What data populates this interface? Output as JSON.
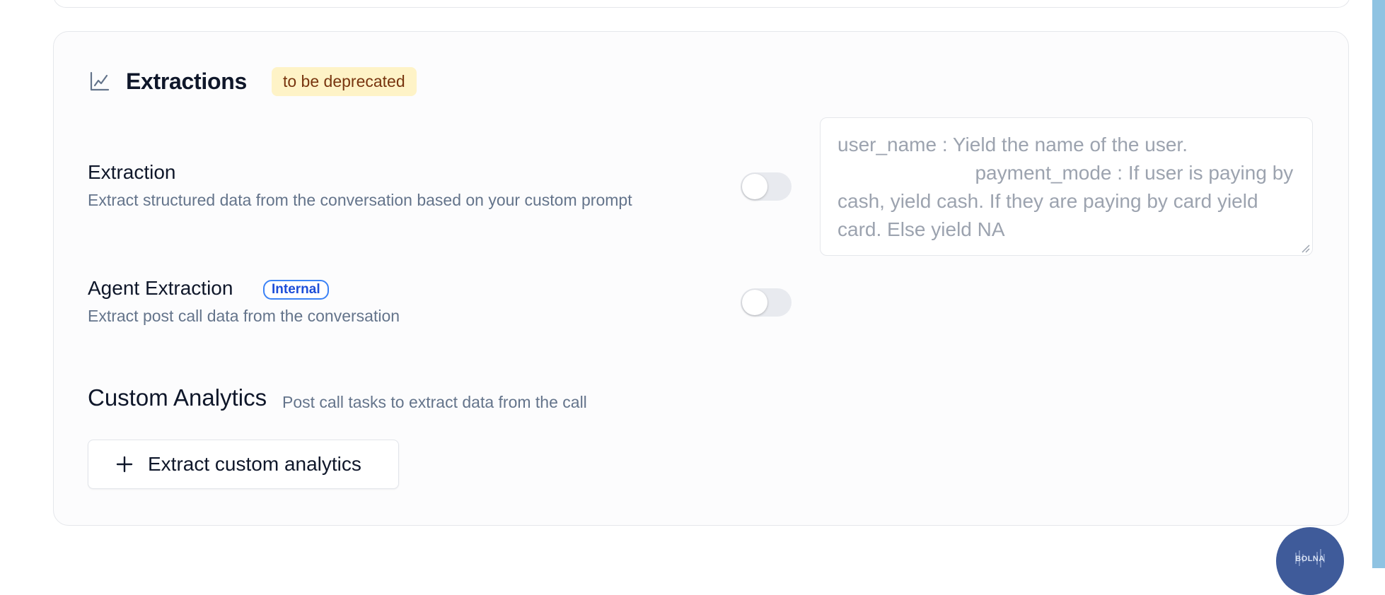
{
  "extractions": {
    "title": "Extractions",
    "badge": "to be deprecated",
    "extraction": {
      "label": "Extraction",
      "description": "Extract structured data from the conversation based on your custom prompt",
      "enabled": false
    },
    "prompt_placeholder": "user_name : Yield the name of the user.\n                         payment_mode : If user is paying by cash, yield cash. If they are paying by card yield card. Else yield NA",
    "agent_extraction": {
      "label": "Agent Extraction",
      "badge": "Internal",
      "description": "Extract post call data from the conversation",
      "enabled": false
    }
  },
  "custom_analytics": {
    "title": "Custom Analytics",
    "subtitle": "Post call tasks to extract data from the call",
    "button_label": "Extract custom analytics"
  },
  "fab": {
    "label": "BOLNA"
  },
  "colors": {
    "badge_bg": "#fef3c7",
    "badge_text": "#78350f",
    "internal_badge": "#1d4ed8",
    "fab_bg": "#3f5b9a",
    "scrollbar": "#8fc3e2"
  }
}
